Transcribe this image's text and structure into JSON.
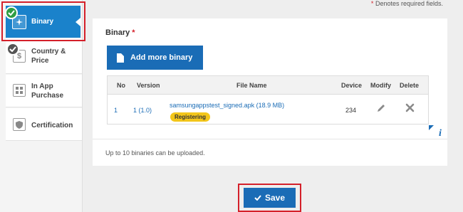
{
  "header": {
    "required_star": "*",
    "required_note": " Denotes required fields."
  },
  "sidebar": {
    "items": [
      {
        "label": "Binary",
        "icon": "binary-icon",
        "status": "completed"
      },
      {
        "label": "Country & Price",
        "icon": "dollar-icon",
        "status": "checked"
      },
      {
        "label": "In App Purchase",
        "icon": "in-app-icon"
      },
      {
        "label": "Certification",
        "icon": "shield-icon"
      }
    ]
  },
  "panel": {
    "title": "Binary",
    "required_star": "*",
    "add_button": "Add more binary",
    "table": {
      "headers": {
        "no": "No",
        "version": "Version",
        "file_name": "File Name",
        "device": "Device",
        "modify": "Modify",
        "delete": "Delete"
      },
      "rows": [
        {
          "no": "1",
          "version": "1 (1.0)",
          "file_name": "samsungappstest_signed.apk (18.9 MB)",
          "status": "Registering",
          "device": "234"
        }
      ]
    },
    "info_glyph": "i",
    "note": "Up to 10 binaries can be uploaded."
  },
  "footer": {
    "save_label": "Save"
  },
  "colors": {
    "accent": "#1a6cb6",
    "active_nav": "#1a82cb",
    "highlight": "#d4202a",
    "status": "#f3c61a",
    "success": "#2e9e44"
  }
}
